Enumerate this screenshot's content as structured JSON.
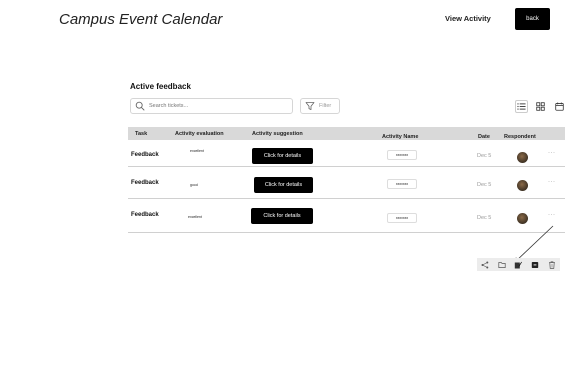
{
  "header": {
    "title": "Campus Event Calendar",
    "view_activity_label": "View Activity",
    "back_label": "back"
  },
  "section": {
    "title": "Active feedback"
  },
  "search": {
    "placeholder": "Search tickets..."
  },
  "filter": {
    "label": "Filter"
  },
  "view_toggles": [
    "list-icon",
    "grid-icon",
    "calendar-icon"
  ],
  "table": {
    "columns": [
      "Task",
      "Activity evaluation",
      "Activity suggestion",
      "Activity Name",
      "Date",
      "Respondent"
    ],
    "rows": [
      {
        "task": "Feedback",
        "evaluation": "excellent",
        "suggestion": "Click for details",
        "name": "xxxxxxx",
        "date": "Dec 5",
        "more": "···"
      },
      {
        "task": "Feedback",
        "evaluation": "good",
        "suggestion": "Click for details",
        "name": "xxxxxxx",
        "date": "Dec 5",
        "more": "···"
      },
      {
        "task": "Feedback",
        "evaluation": "excellent",
        "suggestion": "Click for details",
        "name": "xxxxxxx",
        "date": "Dec 5",
        "more": "···"
      }
    ]
  },
  "row_actions": [
    "share-icon",
    "folder-icon",
    "edit-icon",
    "archive-icon",
    "trash-icon"
  ],
  "colors": {
    "accent": "#000000",
    "header_row": "#d9d9d9",
    "toolbar_bg": "#ececec"
  }
}
